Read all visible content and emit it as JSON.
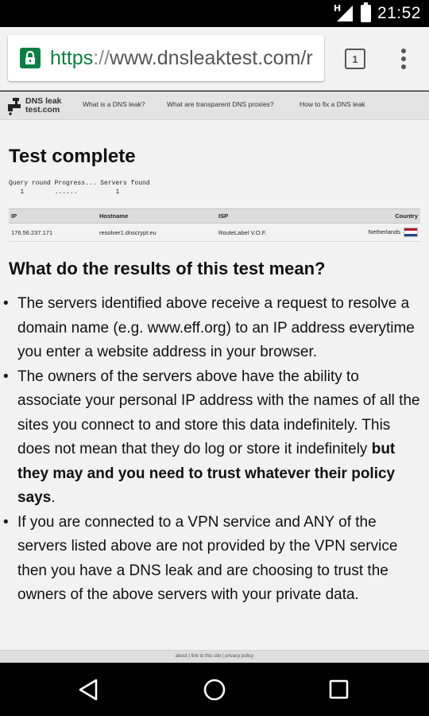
{
  "status_bar": {
    "network_type": "H",
    "time": "21:52"
  },
  "browser": {
    "url_scheme": "https",
    "url_sep": "://",
    "url_rest": "www.dnsleaktest.com/r",
    "tab_count": "1"
  },
  "site": {
    "logo_line1": "DNS leak",
    "logo_line2": "test.com",
    "nav": [
      "What is a DNS leak?",
      "What are transparent DNS proxies?",
      "How to fix a DNS leak"
    ]
  },
  "test": {
    "title": "Test complete",
    "progress_header": "Query round Progress... Servers found",
    "progress_round": "1",
    "progress_dots": "......",
    "progress_found": "1"
  },
  "table": {
    "headers": [
      "IP",
      "Hostname",
      "ISP",
      "Country"
    ],
    "rows": [
      [
        "176.56.237.171",
        "resolver1.dnscrypt.eu",
        "RouteLabel V.O.F.",
        "Netherlands"
      ]
    ],
    "flag_colors": [
      "#ae1c28",
      "#ffffff",
      "#21468b"
    ]
  },
  "results": {
    "heading": "What do the results of this test mean?",
    "bullet1": "The servers identified above receive a request to resolve a domain name (e.g. www.eff.org) to an IP address everytime you enter a website address in your browser.",
    "bullet2_plain": "The owners of the servers above have the ability to associate your personal IP address with the names of all the sites you connect to and store this data indefinitely. This does not mean that they do log or store it indefinitely ",
    "bullet2_bold": "but they may and you need to trust whatever their policy says",
    "bullet2_end": ".",
    "bullet3": "If you are connected to a VPN service and ANY of the servers listed above are not provided by the VPN service then you have a DNS leak and are choosing to trust the owners of the above servers with your private data."
  },
  "footer": {
    "text": "about | link to this site | privacy policy"
  },
  "colors": {
    "secure_green": "#0b8043",
    "page_bg": "#f2f2f2"
  }
}
